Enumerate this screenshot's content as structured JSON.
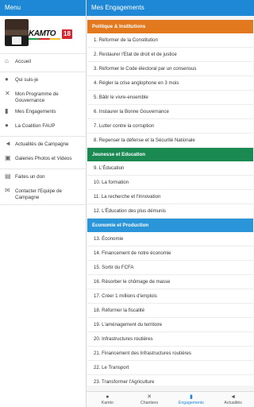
{
  "drawer": {
    "title": "Menu",
    "logo_text": "KAMTO",
    "logo_year": "18",
    "groups": [
      {
        "items": [
          {
            "icon": "home-icon",
            "glyph": "⌂",
            "label": "Accueil"
          }
        ]
      },
      {
        "items": [
          {
            "icon": "person-icon",
            "glyph": "●",
            "label": "Qui suis-je"
          },
          {
            "icon": "tools-icon",
            "glyph": "✕",
            "label": "Mon Programme de Gouvernance"
          },
          {
            "icon": "bookmark-icon",
            "glyph": "▮",
            "label": "Mes Engagements"
          },
          {
            "icon": "people-icon",
            "glyph": "●",
            "label": "La Coalition FAUP"
          }
        ]
      },
      {
        "items": [
          {
            "icon": "megaphone-icon",
            "glyph": "◄",
            "label": "Actualités de Campagne"
          },
          {
            "icon": "gallery-icon",
            "glyph": "▣",
            "label": "Galeries Photos et Videos"
          }
        ]
      },
      {
        "items": [
          {
            "icon": "gift-icon",
            "glyph": "▤",
            "label": "Faites un don"
          },
          {
            "icon": "mail-icon",
            "glyph": "✉",
            "label": "Contacter l'Equipe de Campagne"
          }
        ]
      }
    ]
  },
  "main": {
    "title": "Mes Engagements",
    "sections": [
      {
        "title": "Politique & Institutions",
        "color": "#e3791f",
        "rows": [
          "1.   Réformer de la Constitution",
          "2.   Restaurer l'Etat de droit et de justice",
          "3.   Réformer le Code électoral par un consensus",
          "4.   Régler la crise anglophone en 3 mois",
          "5.   Bâtir le vivre-ensemble",
          "6.   Instaurer la Bonne Gouvernance",
          "7.   Lutter contre la corruption",
          "8.   Repenser la défense et la Sécurité Nationale"
        ]
      },
      {
        "title": "Jeunesse et Education",
        "color": "#1b8a52",
        "rows": [
          "9.  L'Éducation",
          "10.  La formation",
          "11.  La recherche et l'Innovation",
          "12.  L'Éducation des plus démunis"
        ]
      },
      {
        "title": "Economie et Production",
        "color": "#2b95da",
        "rows": [
          "13.  Économie",
          "14.  Financement de notre économie",
          "15.  Sortir du FCFA",
          "16.  Résorber le chômage de masse",
          "17.  Créer 1 millions d'emplois",
          "18.  Réformer la fiscalité",
          "19.  L'aménagement du territoire",
          "20.  Infrastructures routières",
          "21.  Financement des Infrastructures routières",
          "22.  Le Transport",
          "23.  Transformer l'Agriculture"
        ]
      }
    ]
  },
  "tabbar": {
    "tabs": [
      {
        "icon": "person-icon",
        "glyph": "●",
        "label": "Kamto",
        "active": false
      },
      {
        "icon": "tools-icon",
        "glyph": "✕",
        "label": "Chantiers",
        "active": false
      },
      {
        "icon": "bookmark-icon",
        "glyph": "▮",
        "label": "Engagements",
        "active": true
      },
      {
        "icon": "megaphone-icon",
        "glyph": "◄",
        "label": "Actualités",
        "active": false
      }
    ]
  }
}
